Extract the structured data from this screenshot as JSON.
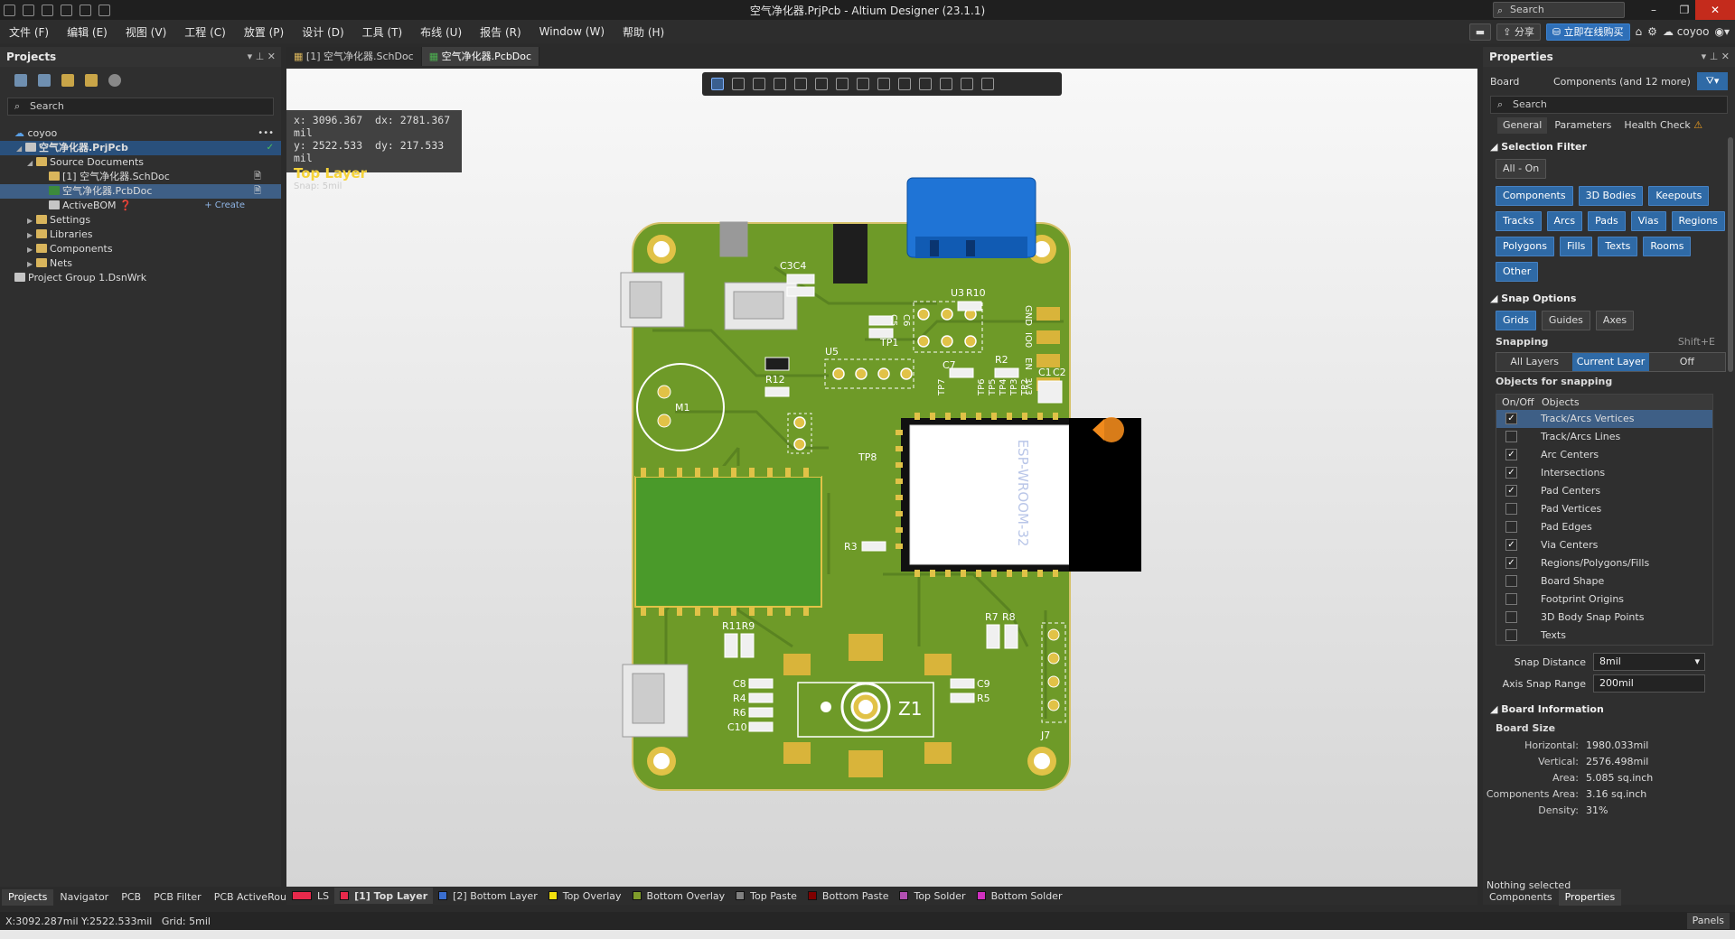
{
  "window": {
    "title": "空气净化器.PrjPcb - Altium Designer (23.1.1)",
    "search_placeholder": "Search",
    "user": "coyoo"
  },
  "menu": [
    "文件 (F)",
    "编辑 (E)",
    "视图 (V)",
    "工程 (C)",
    "放置 (P)",
    "设计 (D)",
    "工具 (T)",
    "布线 (U)",
    "报告 (R)",
    "Window (W)",
    "帮助 (H)"
  ],
  "menu_right": {
    "share": "分享",
    "buy": "立即在线购买"
  },
  "projects_panel": {
    "title": "Projects",
    "search_placeholder": "Search",
    "tree": [
      {
        "label": "coyoo",
        "indent": 0
      },
      {
        "label": "空气净化器.PrjPcb",
        "indent": 1
      },
      {
        "label": "Source Documents",
        "indent": 2
      },
      {
        "label": "[1] 空气净化器.SchDoc",
        "indent": 3
      },
      {
        "label": "空气净化器.PcbDoc",
        "indent": 3
      },
      {
        "label": "ActiveBOM",
        "indent": 3,
        "action": "+ Create"
      },
      {
        "label": "Settings",
        "indent": 2
      },
      {
        "label": "Libraries",
        "indent": 2
      },
      {
        "label": "Components",
        "indent": 2
      },
      {
        "label": "Nets",
        "indent": 2
      },
      {
        "label": "Project Group 1.DsnWrk",
        "indent": 0
      }
    ],
    "bottom_tabs": [
      "Projects",
      "Navigator",
      "PCB",
      "PCB Filter",
      "PCB ActiveRoute"
    ]
  },
  "doc_tabs": [
    "[1] 空气净化器.SchDoc",
    "空气净化器.PcbDoc"
  ],
  "hud": {
    "x": "x:  3096.367",
    "dx": "dx:  2781.367 mil",
    "y": "y:  2522.533",
    "dy": "dy:   217.533  mil",
    "layer": "Top Layer",
    "snap": "Snap: 5mil"
  },
  "pcb": {
    "module_label": "ESP-WROOM-32",
    "refs": [
      "C3C4",
      "U3",
      "R10",
      "TP1",
      "C6",
      "C5",
      "U5",
      "C7",
      "R2",
      "TP7",
      "TP6",
      "TP5",
      "TP4",
      "TP3",
      "TP2",
      "C1",
      "C2",
      "M1",
      "R12",
      "TP8",
      "R3",
      "R11R9",
      "R7",
      "R8",
      "C8",
      "R4",
      "R6",
      "C10",
      "C9",
      "R5",
      "Z1",
      "J7"
    ],
    "pin_labels": [
      "GND",
      "IO0",
      "EN",
      "3V3"
    ]
  },
  "layers": [
    {
      "label": "LS",
      "color": "#e8294b"
    },
    {
      "label": "[1] Top Layer",
      "color": "#e8294b"
    },
    {
      "label": "[2] Bottom Layer",
      "color": "#3a6ecf"
    },
    {
      "label": "Top Overlay",
      "color": "#f2e00d"
    },
    {
      "label": "Bottom Overlay",
      "color": "#809d2b"
    },
    {
      "label": "Top Paste",
      "color": "#808080"
    },
    {
      "label": "Bottom Paste",
      "color": "#800000"
    },
    {
      "label": "Top Solder",
      "color": "#b14fb1"
    },
    {
      "label": "Bottom Solder",
      "color": "#d030c0"
    }
  ],
  "status": {
    "coords": "X:3092.287mil Y:2522.533mil",
    "grid": "Grid: 5mil",
    "panels": "Panels"
  },
  "properties": {
    "title": "Properties",
    "board": "Board",
    "filter": "Components (and 12 more)",
    "search_placeholder": "Search",
    "tabs": [
      "General",
      "Parameters",
      "Health Check"
    ],
    "selection_filter": "Selection Filter",
    "all_on": "All - On",
    "filter_chips": [
      "Components",
      "3D Bodies",
      "Keepouts",
      "Tracks",
      "Arcs",
      "Pads",
      "Vias",
      "Regions",
      "Polygons",
      "Fills",
      "Texts",
      "Rooms",
      "Other"
    ],
    "snap_options": "Snap Options",
    "snap_modes": [
      "Grids",
      "Guides",
      "Axes"
    ],
    "snapping": "Snapping",
    "snapping_hotkey": "Shift+E",
    "snapping_modes": [
      "All Layers",
      "Current Layer",
      "Off"
    ],
    "objects_for_snapping": "Objects for snapping",
    "obj_headers": [
      "On/Off",
      "Objects"
    ],
    "objects": [
      {
        "name": "Track/Arcs Vertices",
        "on": true
      },
      {
        "name": "Track/Arcs Lines",
        "on": false
      },
      {
        "name": "Arc Centers",
        "on": true
      },
      {
        "name": "Intersections",
        "on": true
      },
      {
        "name": "Pad Centers",
        "on": true
      },
      {
        "name": "Pad Vertices",
        "on": false
      },
      {
        "name": "Pad Edges",
        "on": false
      },
      {
        "name": "Via Centers",
        "on": true
      },
      {
        "name": "Regions/Polygons/Fills",
        "on": true
      },
      {
        "name": "Board Shape",
        "on": false
      },
      {
        "name": "Footprint Origins",
        "on": false
      },
      {
        "name": "3D Body Snap Points",
        "on": false
      },
      {
        "name": "Texts",
        "on": false
      }
    ],
    "snap_distance_label": "Snap Distance",
    "snap_distance": "8mil",
    "axis_snap_label": "Axis Snap Range",
    "axis_snap": "200mil",
    "board_info": "Board Information",
    "board_size": "Board Size",
    "size_rows": [
      {
        "k": "Horizontal:",
        "v": "1980.033mil"
      },
      {
        "k": "Vertical:",
        "v": "2576.498mil"
      },
      {
        "k": "Area:",
        "v": "5.085 sq.inch"
      },
      {
        "k": "Components Area:",
        "v": "3.16 sq.inch"
      },
      {
        "k": "Density:",
        "v": "31%"
      }
    ],
    "nothing_selected": "Nothing selected",
    "bottom_tabs": [
      "Components",
      "Properties"
    ]
  }
}
